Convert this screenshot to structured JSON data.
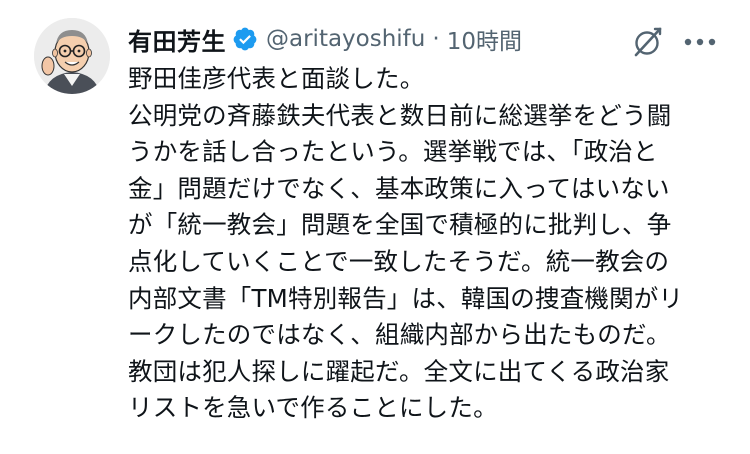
{
  "post": {
    "author": {
      "display_name": "有田芳生",
      "handle": "@aritayoshifu",
      "verified": true,
      "avatar_icon": "caricature-avatar"
    },
    "separator": "·",
    "timestamp": "10時間",
    "actions": {
      "grok_icon": "grok-icon",
      "more_icon": "more-options-icon"
    },
    "lines": [
      "野田佳彦代表と面談した。",
      "公明党の斉藤鉄夫代表と数日前に総選挙をどう闘",
      "うかを話し合ったという。選挙戦では、「政治と",
      "金」問題だけでなく、基本政策に入ってはいない",
      "が「統一教会」問題を全国で積極的に批判し、争",
      "点化していくことで一致したそうだ。統一教会の",
      "内部文書「TM特別報告」は、韓国の捜査機関がリ",
      "ークしたのではなく、組織内部から出たものだ。",
      "教団は犯人探しに躍起だ。全文に出てくる政治家",
      "リストを急いで作ることにした。"
    ]
  },
  "colors": {
    "text_primary": "#0f1419",
    "text_secondary": "#536471",
    "verified_blue": "#1d9bf0",
    "background": "#ffffff"
  }
}
